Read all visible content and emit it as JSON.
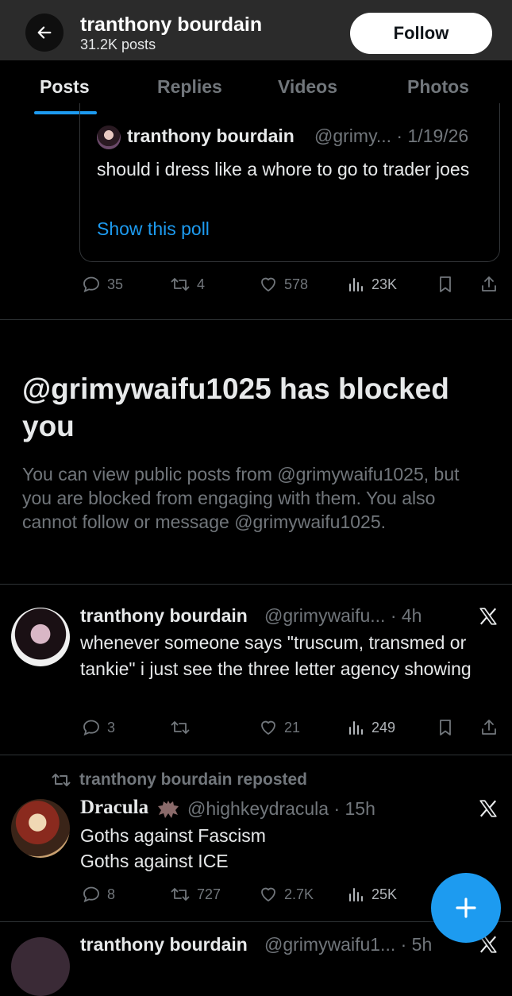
{
  "header": {
    "name": "tranthony bourdain",
    "post_count": "31.2K posts",
    "follow_label": "Follow"
  },
  "tabs": [
    {
      "label": "Posts",
      "active": true
    },
    {
      "label": "Replies"
    },
    {
      "label": "Videos"
    },
    {
      "label": "Photos"
    }
  ],
  "quote": {
    "name": "tranthony bourdain",
    "meta": "@grimy... · 1/19/26",
    "text": "should i dress like a whore to go to trader joes",
    "link": "Show this poll"
  },
  "post0_actions": {
    "replies": "35",
    "reposts": "4",
    "likes": "578",
    "views": "23K"
  },
  "blocked": {
    "title": "@grimywaifu1025 has blocked you",
    "body": "You can view public posts from @grimywaifu1025, but you are blocked from engaging with them. You also cannot follow or message @grimywaifu1025."
  },
  "post1": {
    "name": "tranthony bourdain",
    "meta": "@grimywaifu... · 4h",
    "text": "whenever someone says \"truscum, transmed or tankie\" i just see the three letter agency showing",
    "actions": {
      "replies": "3",
      "reposts": "",
      "likes": "21",
      "views": "249"
    }
  },
  "post2": {
    "repost_label": "tranthony bourdain reposted",
    "name": "Dracula",
    "meta": "@highkeydracula · 15h",
    "line1": "Goths against Fascism",
    "line2": "Goths against ICE",
    "actions": {
      "replies": "8",
      "reposts": "727",
      "likes": "2.7K",
      "views": "25K"
    }
  },
  "post3": {
    "name": "tranthony bourdain",
    "meta": "@grimywaifu1... · 5h"
  },
  "icons": [
    "back-arrow-icon",
    "reply-icon",
    "repost-icon",
    "like-icon",
    "views-icon",
    "bookmark-icon",
    "share-icon",
    "x-logo-icon",
    "bat-icon",
    "plus-icon"
  ],
  "colors": {
    "accent": "#1d9bf0",
    "muted": "#71767b",
    "text": "#e7e9ea",
    "background": "#000000"
  }
}
